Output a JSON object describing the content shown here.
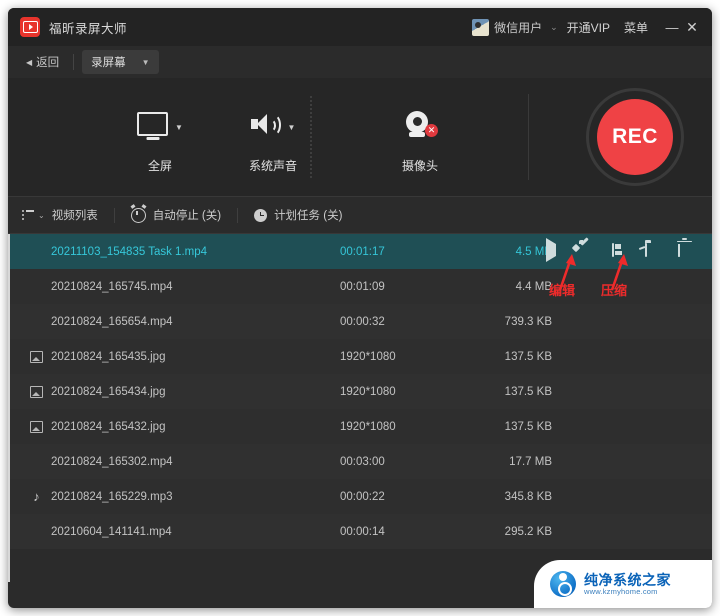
{
  "titlebar": {
    "app_title": "福昕录屏大师",
    "logo_icon": "app-logo-play-icon",
    "user_name": "微信用户",
    "user_chevron": "⌄",
    "vip_label": "开通VIP",
    "menu_label": "菜单",
    "minimize_label": "—",
    "close_label": "✕"
  },
  "subbar": {
    "back_caret": "◀",
    "back_label": "返回",
    "mode_label": "录屏幕",
    "mode_caret": "▼"
  },
  "capture": {
    "items": [
      {
        "label": "全屏",
        "icon": "monitor-icon",
        "caret": "▼"
      },
      {
        "label": "系统声音",
        "icon": "speaker-icon",
        "caret": "▼"
      },
      {
        "label": "摄像头",
        "icon": "webcam-off-icon",
        "badge": "✕"
      }
    ],
    "rec_label": "REC",
    "rec_color": "#ef4245"
  },
  "listbar": {
    "video_list_label": "视频列表",
    "video_list_caret": "⌄",
    "auto_stop_label": "自动停止 (关)",
    "schedule_label": "计划任务 (关)"
  },
  "filelist": {
    "rows": [
      {
        "name": "20211103_154835 Task 1.mp4",
        "duration": "00:01:17",
        "size": "4.5 MB",
        "icon": "",
        "selected": true
      },
      {
        "name": "20210824_165745.mp4",
        "duration": "00:01:09",
        "size": "4.4 MB",
        "icon": "",
        "selected": false
      },
      {
        "name": "20210824_165654.mp4",
        "duration": "00:00:32",
        "size": "739.3 KB",
        "icon": "",
        "selected": false
      },
      {
        "name": "20210824_165435.jpg",
        "duration": "1920*1080",
        "size": "137.5 KB",
        "icon": "image-icon",
        "selected": false
      },
      {
        "name": "20210824_165434.jpg",
        "duration": "1920*1080",
        "size": "137.5 KB",
        "icon": "image-icon",
        "selected": false
      },
      {
        "name": "20210824_165432.jpg",
        "duration": "1920*1080",
        "size": "137.5 KB",
        "icon": "image-icon",
        "selected": false
      },
      {
        "name": "20210824_165302.mp4",
        "duration": "00:03:00",
        "size": "17.7 MB",
        "icon": "",
        "selected": false
      },
      {
        "name": "20210824_165229.mp3",
        "duration": "00:00:22",
        "size": "345.8 KB",
        "icon": "music-note-icon",
        "selected": false
      },
      {
        "name": "20210604_141141.mp4",
        "duration": "00:00:14",
        "size": "295.2 KB",
        "icon": "",
        "selected": false
      }
    ],
    "row_actions": [
      "play-icon",
      "edit-icon",
      "compress-icon",
      "folder-icon",
      "trash-icon"
    ]
  },
  "annotations": {
    "edit_label": "编辑",
    "compress_label": "压缩",
    "color": "#ee2b2b"
  },
  "watermark": {
    "site_name": "纯净系统之家",
    "site_url": "www.kzmyhome.com"
  }
}
